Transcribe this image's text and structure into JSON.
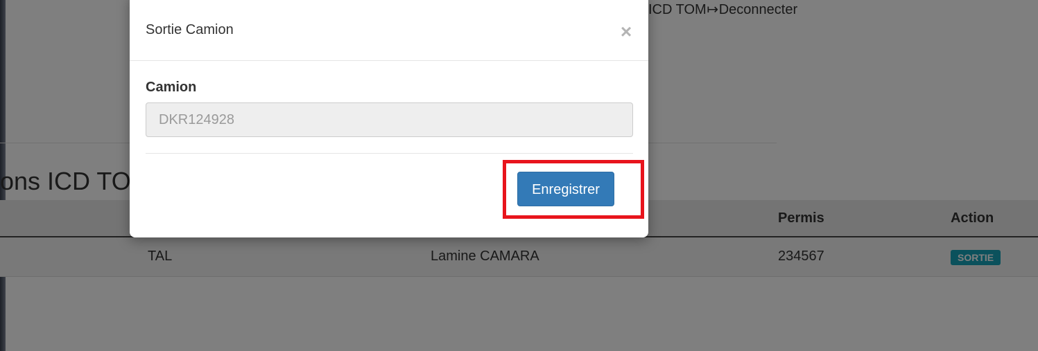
{
  "background": {
    "user_nav": {
      "org_text": "ICD TOM",
      "logout_icon": "↦",
      "logout_label": "Deconnecter"
    },
    "section_title": "ons ICD TO",
    "table": {
      "headers": {
        "permis": "Permis",
        "action": "Action"
      },
      "rows": [
        {
          "col_a": "TAL",
          "driver": "Lamine CAMARA",
          "permis": "234567",
          "status": "SORTIE"
        }
      ]
    }
  },
  "modal": {
    "title": "Sortie Camion",
    "close_glyph": "×",
    "field_label": "Camion",
    "field_placeholder": "DKR124928",
    "field_value": "",
    "submit_label": "Enregistrer"
  },
  "colors": {
    "primary": "#337ab7",
    "status_badge": "#17a2b8",
    "highlight": "#e8141c"
  }
}
